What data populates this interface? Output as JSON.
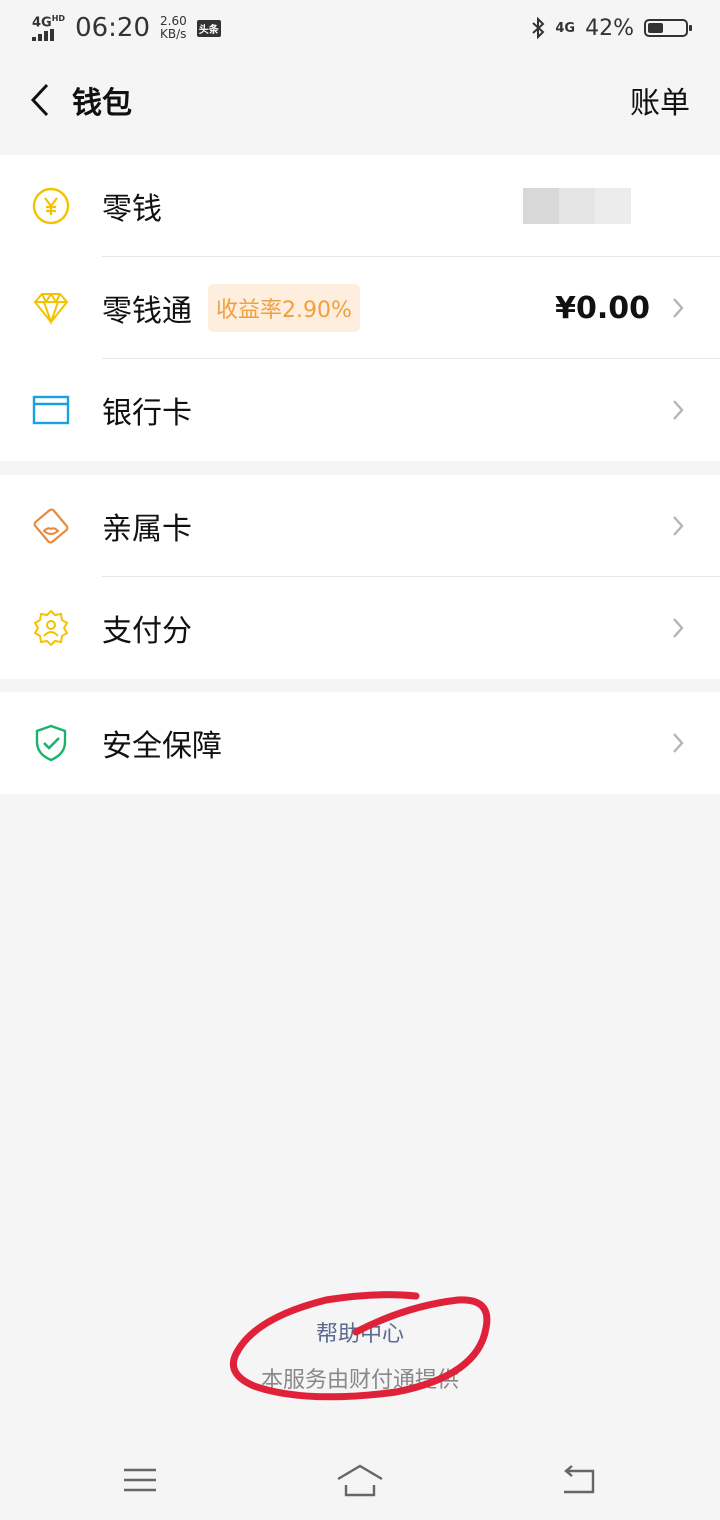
{
  "status_bar": {
    "network": "4G",
    "network_suffix": "HD",
    "time": "06:20",
    "speed_value": "2.60",
    "speed_unit": "KB/s",
    "app_badge": "头条",
    "network_right": "4G",
    "battery": "42%",
    "battery_level": 0.42
  },
  "nav": {
    "title": "钱包",
    "bill": "账单"
  },
  "group1": {
    "items": [
      {
        "label": "零钱",
        "icon": "yen-coin-icon",
        "color": "#f3c200"
      },
      {
        "label": "零钱通",
        "tag": "收益率2.90%",
        "amount": "¥0.00",
        "icon": "diamond-icon",
        "color": "#f3c200"
      },
      {
        "label": "银行卡",
        "icon": "bank-card-icon",
        "color": "#1aa1e0"
      }
    ]
  },
  "group2": {
    "items": [
      {
        "label": "亲属卡",
        "icon": "family-card-icon",
        "color": "#e88a3c"
      },
      {
        "label": "支付分",
        "icon": "pay-score-icon",
        "color": "#f3c200"
      }
    ]
  },
  "group3": {
    "items": [
      {
        "label": "安全保障",
        "icon": "shield-check-icon",
        "color": "#19b36b"
      }
    ]
  },
  "footer": {
    "help": "帮助中心",
    "provider": "本服务由财付通提供"
  },
  "colors": {
    "accent_tag_text": "#f0a040",
    "accent_tag_bg": "#fdeedd",
    "link": "#5b6a91",
    "annotation": "#e0213a"
  }
}
